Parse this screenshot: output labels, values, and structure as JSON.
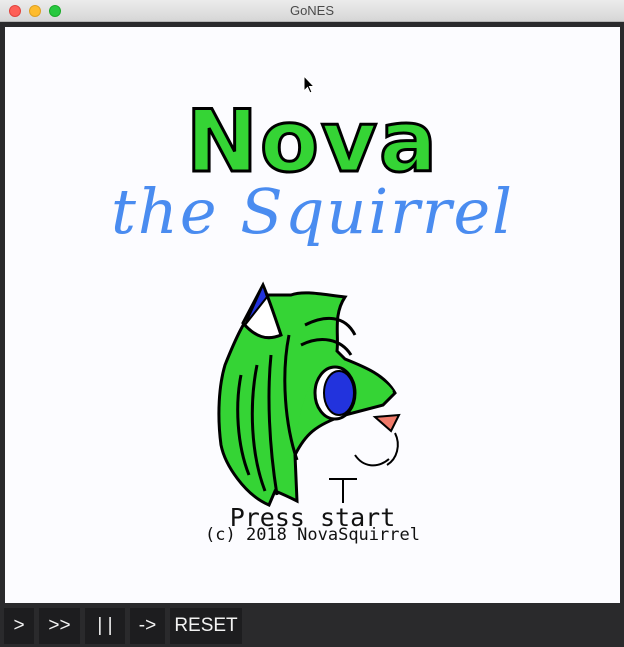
{
  "window": {
    "title": "GoNES"
  },
  "game": {
    "title_main": "Nova",
    "title_sub": "the Squirrel",
    "prompt": "Press start",
    "copyright": "(c) 2018 NovaSquirrel"
  },
  "toolbar": {
    "play_label": ">",
    "fast_forward_label": ">>",
    "pause_label": "| |",
    "step_label": "->",
    "reset_label": "RESET"
  },
  "colors": {
    "nova_green": "#35d435",
    "sub_blue": "#4a8cf0",
    "eye_blue": "#2233dd",
    "nose_pink": "#f07a6a"
  }
}
